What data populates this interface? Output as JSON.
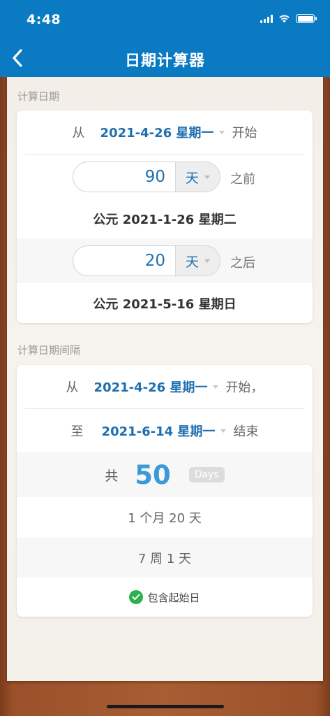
{
  "status_bar": {
    "time": "4:48"
  },
  "nav": {
    "title": "日期计算器"
  },
  "section1": {
    "label": "计算日期",
    "from_prefix": "从",
    "from_date": "2021-4-26 星期一",
    "from_suffix": "开始",
    "before": {
      "value": "90",
      "unit": "天",
      "suffix": "之前",
      "result": "公元 2021-1-26 星期二"
    },
    "after": {
      "value": "20",
      "unit": "天",
      "suffix": "之后",
      "result": "公元 2021-5-16 星期日"
    }
  },
  "section2": {
    "label": "计算日期间隔",
    "from_prefix": "从",
    "from_date": "2021-4-26 星期一",
    "from_suffix": "开始，",
    "to_prefix": "至",
    "to_date": "2021-6-14 星期一",
    "to_suffix": "结束",
    "total_label": "共",
    "total_value": "50",
    "total_unit": "Days",
    "months_days": "1 个月 20 天",
    "weeks_days": "7 周 1 天",
    "include_start_label": "包含起始日",
    "include_start_checked": true
  },
  "colors": {
    "header": "#0a7ac2",
    "accent": "#1f6fb0",
    "total": "#3a9ad6",
    "check": "#2bb24c"
  }
}
